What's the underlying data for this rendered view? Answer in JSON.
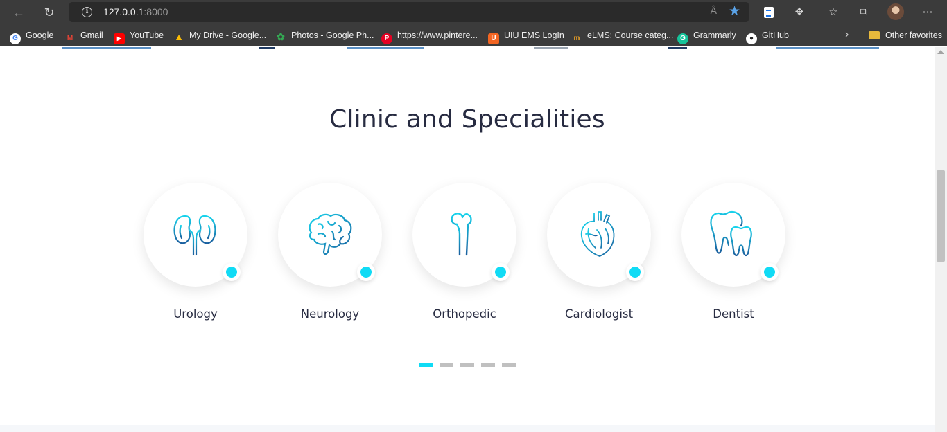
{
  "browser": {
    "url_host": "127.0.0.1",
    "url_port": ":8000",
    "read_aloud_icon": "Â",
    "bookmarks": [
      {
        "label": "Google",
        "icon": "google-icon"
      },
      {
        "label": "Gmail",
        "icon": "gmail-icon"
      },
      {
        "label": "YouTube",
        "icon": "youtube-icon"
      },
      {
        "label": "My Drive - Google...",
        "icon": "drive-icon"
      },
      {
        "label": "Photos - Google Ph...",
        "icon": "photos-icon"
      },
      {
        "label": "https://www.pintere...",
        "icon": "pinterest-icon"
      },
      {
        "label": "UIU EMS LogIn",
        "icon": "uiu-icon"
      },
      {
        "label": "eLMS: Course categ...",
        "icon": "elms-icon"
      },
      {
        "label": "Grammarly",
        "icon": "grammarly-icon"
      },
      {
        "label": "GitHub",
        "icon": "github-icon"
      }
    ],
    "other_favorites": "Other favorites"
  },
  "section": {
    "title": "Clinic and Specialities",
    "specialities": [
      {
        "label": "Urology",
        "icon": "kidney-icon"
      },
      {
        "label": "Neurology",
        "icon": "brain-icon"
      },
      {
        "label": "Orthopedic",
        "icon": "bone-icon"
      },
      {
        "label": "Cardiologist",
        "icon": "heart-icon"
      },
      {
        "label": "Dentist",
        "icon": "tooth-icon"
      }
    ],
    "pager": {
      "count": 5,
      "active": 0
    }
  },
  "colors": {
    "accent": "#10dbf5",
    "title": "#272b41",
    "icon_stroke": "#1a7fa8",
    "chrome": "#3b3b3b"
  }
}
